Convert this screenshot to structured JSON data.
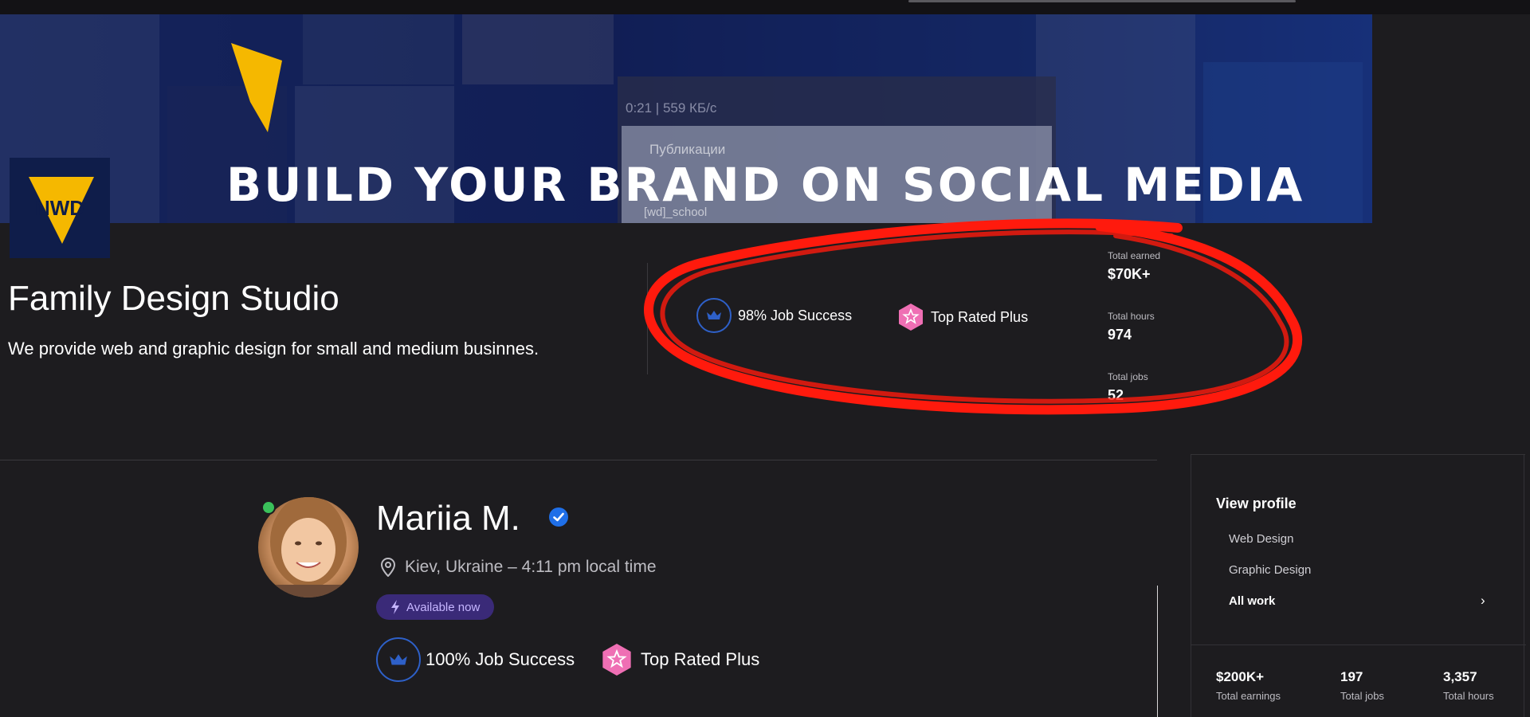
{
  "banner": {
    "headline": "BUILD YOUR BRAND ON SOCIAL MEDIA",
    "phone_status": "0:21 | 559 КБ/с",
    "phone_title": "Публикации",
    "phone_handle": "[wd]_school"
  },
  "agency": {
    "logo_text": "NWD",
    "name": "Family Design Studio",
    "description": "We provide web and graphic design for small and medium businnes.",
    "job_success": "98% Job Success",
    "top_rated": "Top Rated Plus",
    "stats": [
      {
        "label": "Total earned",
        "value": "$70K+"
      },
      {
        "label": "Total hours",
        "value": "974"
      },
      {
        "label": "Total jobs",
        "value": "52"
      }
    ]
  },
  "freelancer": {
    "name": "Mariia M.",
    "location": "Kiev, Ukraine – 4:11 pm local time",
    "availability": "Available now",
    "job_success": "100% Job Success",
    "top_rated": "Top Rated Plus"
  },
  "side_panel": {
    "view_profile": "View profile",
    "links": [
      "Web Design",
      "Graphic Design",
      "All work"
    ],
    "stats": [
      {
        "value": "$200K+",
        "label": "Total earnings"
      },
      {
        "value": "197",
        "label": "Total jobs"
      },
      {
        "value": "3,357",
        "label": "Total hours"
      }
    ]
  },
  "colors": {
    "background": "#1d1c1f",
    "brand_yellow": "#f5b800",
    "job_success_blue": "#2e60c8",
    "top_rated_pink": "#ef6fb4",
    "annotation_red": "#ff1a0d",
    "available_purple": "#3a2a78",
    "online_green": "#3ac05a",
    "verified_blue": "#1f6fe8"
  },
  "icons": {
    "job_success": "crown-icon",
    "top_rated": "star-badge-icon",
    "location": "location-pin-icon",
    "verified": "verified-check-icon",
    "available": "lightning-icon",
    "chevron": "chevron-right-icon"
  }
}
